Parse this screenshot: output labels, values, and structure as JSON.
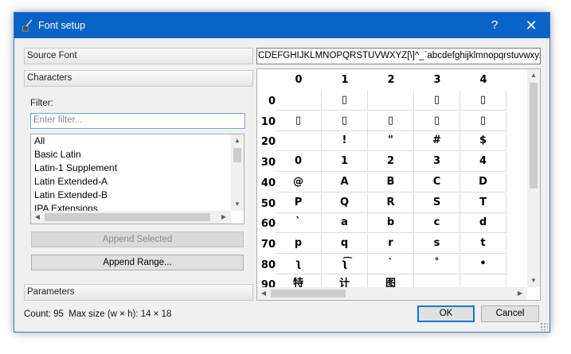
{
  "window": {
    "title": "Font setup",
    "help_label": "?",
    "close_label": "✕"
  },
  "sections": {
    "source_font": "Source Font",
    "characters": "Characters",
    "parameters": "Parameters"
  },
  "filter": {
    "label": "Filter:",
    "placeholder": "Enter filter..."
  },
  "ranges": [
    "All",
    "Basic Latin",
    "Latin-1 Supplement",
    "Latin Extended-A",
    "Latin Extended-B",
    "IPA Extensions"
  ],
  "buttons": {
    "append_selected": "Append Selected",
    "append_range": "Append Range...",
    "ok": "OK",
    "cancel": "Cancel"
  },
  "glyph_string": "CDEFGHIJKLMNOPQRSTUVWXYZ[\\]^_`abcdefghijklmnopqrstuvwxyz{|}~",
  "grid": {
    "columns": [
      "0",
      "1",
      "2",
      "3",
      "4"
    ],
    "rows": [
      {
        "label": "0",
        "cells": [
          "",
          "▯",
          "",
          "▯",
          "▯"
        ]
      },
      {
        "label": "10",
        "cells": [
          "▯",
          "▯",
          "▯",
          "▯",
          "▯"
        ]
      },
      {
        "label": "20",
        "cells": [
          "",
          "!",
          "\"",
          "#",
          "$"
        ]
      },
      {
        "label": "30",
        "cells": [
          "0",
          "1",
          "2",
          "3",
          "4"
        ]
      },
      {
        "label": "40",
        "cells": [
          "@",
          "A",
          "B",
          "C",
          "D"
        ]
      },
      {
        "label": "50",
        "cells": [
          "P",
          "Q",
          "R",
          "S",
          "T"
        ]
      },
      {
        "label": "60",
        "cells": [
          "`",
          "a",
          "b",
          "c",
          "d"
        ]
      },
      {
        "label": "70",
        "cells": [
          "p",
          "q",
          "r",
          "s",
          "t"
        ]
      },
      {
        "label": "80",
        "cells": [
          "ʅ",
          "ʅ͡",
          "ˋ",
          "˚",
          "•"
        ]
      },
      {
        "label": "90",
        "cells": [
          "特",
          "计",
          "图",
          "",
          ""
        ]
      }
    ]
  },
  "status": {
    "count": "Count: 95",
    "max_size": "Max size (w × h): 14 × 18"
  },
  "icons": {
    "app": "broom-icon"
  }
}
